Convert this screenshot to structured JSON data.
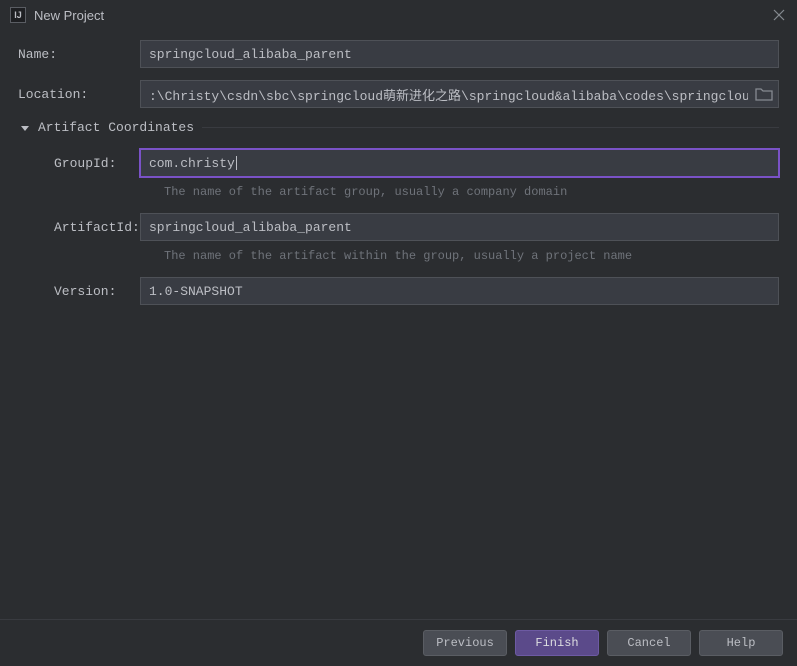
{
  "window": {
    "title": "New Project"
  },
  "fields": {
    "name": {
      "label": "Name:",
      "value": "springcloud_alibaba_parent"
    },
    "location": {
      "label": "Location:",
      "value": ":\\Christy\\csdn\\sbc\\springcloud萌新进化之路\\springcloud&alibaba\\codes\\springcloud_alibaba"
    }
  },
  "section": {
    "title": "Artifact Coordinates"
  },
  "artifact": {
    "groupId": {
      "label": "GroupId:",
      "value": "com.christy",
      "hint": "The name of the artifact group, usually a company domain"
    },
    "artifactId": {
      "label": "ArtifactId:",
      "value": "springcloud_alibaba_parent",
      "hint": "The name of the artifact within the group, usually a project name"
    },
    "version": {
      "label": "Version:",
      "value": "1.0-SNAPSHOT"
    }
  },
  "buttons": {
    "previous": "Previous",
    "finish": "Finish",
    "cancel": "Cancel",
    "help": "Help"
  }
}
